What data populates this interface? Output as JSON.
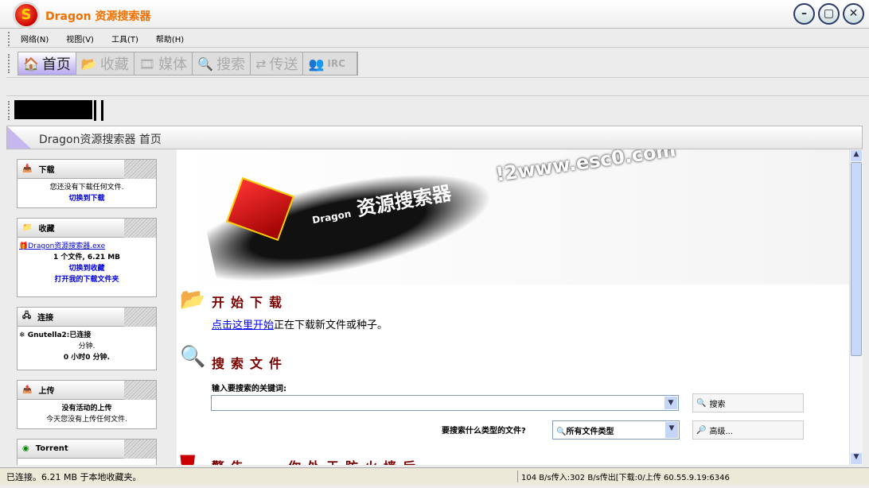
{
  "window": {
    "title": "Dragon 资源搜索器",
    "logo_letter": "S"
  },
  "menu": [
    "网络(N)",
    "视图(V)",
    "工具(T)",
    "帮助(H)"
  ],
  "toolbar": [
    {
      "label": "首页",
      "icon": "home-icon",
      "glyph": "🏠"
    },
    {
      "label": "收藏",
      "icon": "folder-icon",
      "glyph": "📂"
    },
    {
      "label": "媒体",
      "icon": "film-icon",
      "glyph": "🎞"
    },
    {
      "label": "搜索",
      "icon": "magnifier-icon",
      "glyph": "🔍"
    },
    {
      "label": "传送",
      "icon": "transfer-icon",
      "glyph": "⇄"
    },
    {
      "label": "IRC",
      "icon": "users-icon",
      "glyph": "👥"
    }
  ],
  "page_header": "Dragon资源搜索器 首页",
  "sidebar": {
    "download": {
      "title": "下载",
      "text": "您还没有下载任何文件.",
      "link": "切换到下载"
    },
    "library": {
      "title": "收藏",
      "file": "Dragon资源搜索器.exe",
      "summary": "1 个文件, 6.21 MB",
      "link1": "切换到收藏",
      "link2": "打开我的下载文件夹"
    },
    "connection": {
      "title": "连接",
      "network": "Gnutella2:已连接",
      "line1": "分钟.",
      "line2": "0 小时0 分钟."
    },
    "upload": {
      "title": "上传",
      "text1": "没有活动的上传",
      "text2": "今天您没有上传任何文件."
    },
    "torrent": {
      "title": "Torrent"
    }
  },
  "banner": {
    "brand": "Dragon",
    "title": "资源搜索器",
    "site": "!2www.esc0.com"
  },
  "start": {
    "title": "开始下载",
    "link": "点击这里开始",
    "text": "正在下载新文件或种子。"
  },
  "search": {
    "title": "搜索文件",
    "label": "输入要搜索的关键词:",
    "input_value": "",
    "button": "搜索",
    "type_label": "要搜索什么类型的文件?",
    "type_value": "所有文件类型",
    "advanced": "高级..."
  },
  "warning": {
    "title": "警告",
    "text": "你处于防火墙后"
  },
  "status": {
    "left": "已连接。6.21 MB 于本地收藏夹。",
    "right": "104 B/s传入:302 B/s传出[下载:0/上传 60.55.9.19:6346"
  }
}
